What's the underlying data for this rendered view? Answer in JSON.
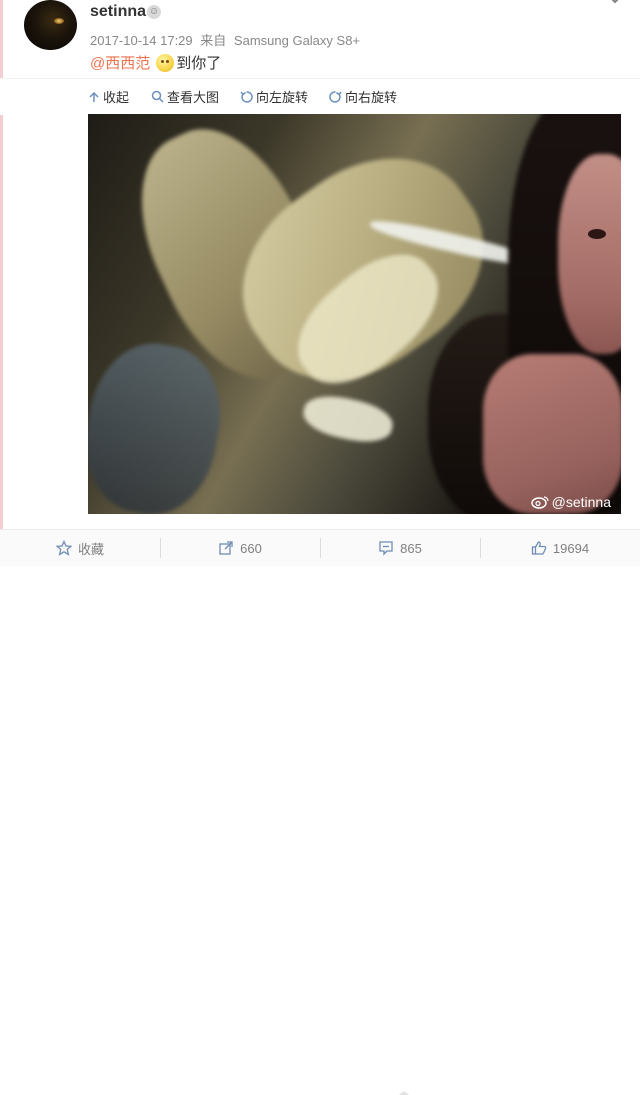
{
  "post": {
    "username": "setinna",
    "meta": {
      "date": "2017-10-14 17:29",
      "source_prefix": "来自",
      "source": "Samsung Galaxy S8+"
    },
    "content": {
      "mention": "@西西范",
      "emoji": "smile-emoji",
      "text": "到你了"
    }
  },
  "toolbar": {
    "collapse_label": "收起",
    "view_large_label": "查看大图",
    "rotate_left_label": "向左旋转",
    "rotate_right_label": "向右旋转"
  },
  "photo": {
    "watermark": "@setinna"
  },
  "actions": {
    "favorite_label": "收藏",
    "repost_count": "660",
    "comment_count": "865",
    "like_count": "19694"
  },
  "colors": {
    "mention": "#eb7350",
    "action_text": "#808080"
  },
  "icons": {
    "collapse": "collapse-arrow-icon",
    "view_large": "search-icon",
    "rotate_left": "rotate-left-icon",
    "rotate_right": "rotate-right-icon",
    "favorite": "star-icon",
    "repost": "repost-icon",
    "comment": "comment-icon",
    "like": "thumbs-up-icon"
  }
}
